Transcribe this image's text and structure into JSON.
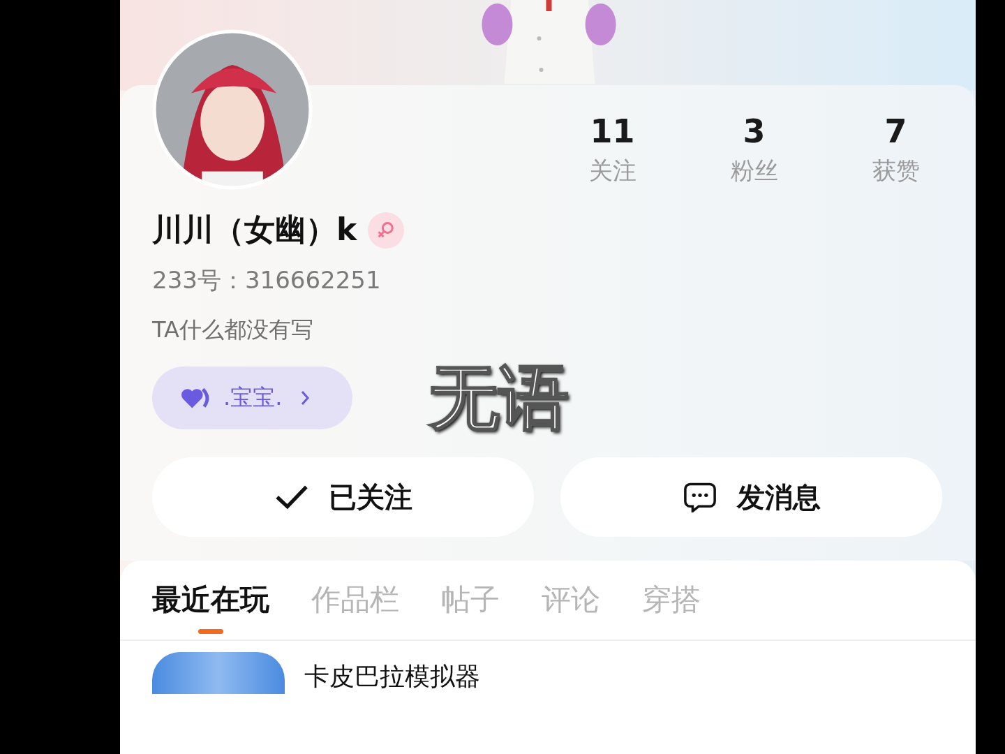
{
  "profile": {
    "stats": [
      {
        "value": "11",
        "label": "关注"
      },
      {
        "value": "3",
        "label": "粉丝"
      },
      {
        "value": "7",
        "label": "获赞"
      }
    ],
    "name": "川川（女幽）k",
    "female": true,
    "id_line": "233号：316662251",
    "bio": "TA什么都没有写",
    "relation_badge": {
      "label": ".宝宝.",
      "color": "#6a5ae0"
    },
    "buttons": [
      {
        "label": "已关注",
        "kind": "followed"
      },
      {
        "label": "发消息",
        "kind": "message"
      }
    ]
  },
  "caption": "无语",
  "tabs": [
    {
      "label": "最近在玩",
      "selected": true
    },
    {
      "label": "作品栏",
      "selected": false
    },
    {
      "label": "帖子",
      "selected": false
    },
    {
      "label": "评论",
      "selected": false
    },
    {
      "label": "穿搭",
      "selected": false
    }
  ],
  "games": [
    {
      "title": "卡皮巴拉模拟器"
    }
  ]
}
